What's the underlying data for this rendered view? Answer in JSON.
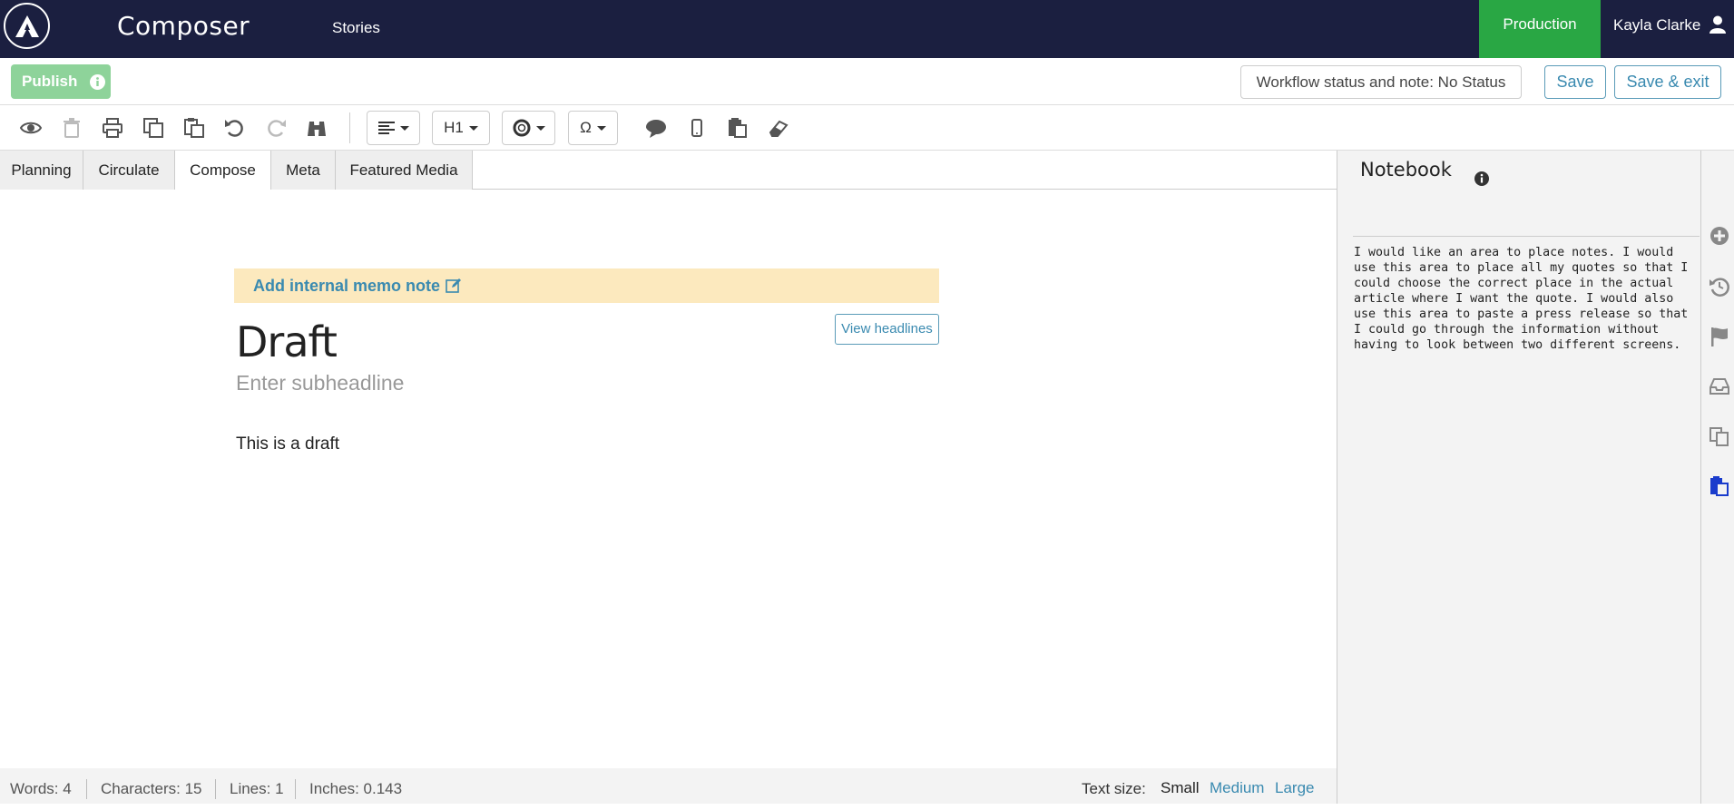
{
  "app": {
    "title": "Composer",
    "nav_stories": "Stories",
    "environment": "Production",
    "user_name": "Kayla Clarke",
    "colors": {
      "nav_bg": "#1b1f40",
      "env_bg": "#29a744",
      "accent": "#3a8ab0",
      "memo_bg": "#fce9be"
    }
  },
  "actionbar": {
    "publish_label": "Publish",
    "workflow_label": "Workflow status and note: No Status",
    "save_label": "Save",
    "save_exit_label": "Save & exit"
  },
  "toolbar": {
    "icons": [
      "eye-icon",
      "trash-icon",
      "print-icon",
      "copy-icon",
      "paste-icon",
      "undo-icon",
      "redo-icon",
      "binoculars-icon",
      "align-icon",
      "lifebuoy-icon",
      "omega-icon",
      "comment-icon",
      "mobile-icon",
      "clipboard-icon",
      "eraser-icon"
    ],
    "heading_dropdown": "H1",
    "special_char": "Ω"
  },
  "tabs": [
    {
      "label": "Planning"
    },
    {
      "label": "Circulate"
    },
    {
      "label": "Compose",
      "active": true
    },
    {
      "label": "Meta"
    },
    {
      "label": "Featured Media"
    }
  ],
  "editor": {
    "memo_label": "Add internal memo note",
    "headline": "Draft",
    "view_headlines_label": "View headlines",
    "subheadline_placeholder": "Enter subheadline",
    "body": "This is a draft"
  },
  "status": {
    "words": "Words: 4",
    "characters": "Characters: 15",
    "lines": "Lines: 1",
    "inches": "Inches: 0.143",
    "text_size_label": "Text size:",
    "sizes": [
      "Small",
      "Medium",
      "Large"
    ],
    "selected_size": "Small"
  },
  "notebook": {
    "title": "Notebook",
    "text": "I would like an area to place notes. I would use this area to place all my quotes so that I could choose the correct place in the actual article where I want the quote. I would also use this area to paste a press release so that I could go through the information without having to look between two different screens."
  },
  "rail": {
    "icons": [
      "plus-circle-icon",
      "history-icon",
      "flag-icon",
      "inbox-icon",
      "copy-icon",
      "clipboard-icon"
    ]
  }
}
